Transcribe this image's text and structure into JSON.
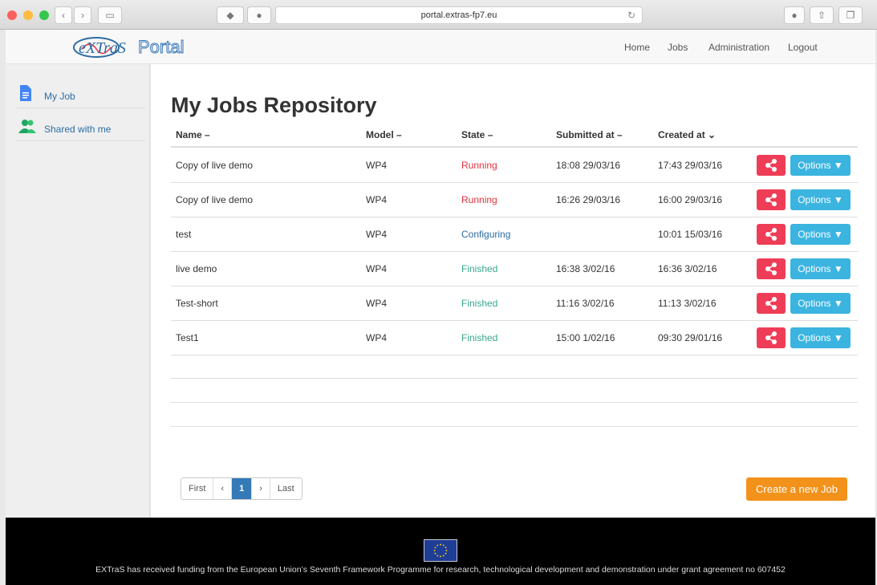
{
  "browser": {
    "url": "portal.extras-fp7.eu"
  },
  "header": {
    "logo_main": "eXTraS",
    "logo_sub": "Portal",
    "nav": [
      "Home",
      "Jobs",
      "Administration",
      "Logout"
    ]
  },
  "sidebar": {
    "items": [
      {
        "label": "My Job",
        "icon": "document-icon"
      },
      {
        "label": "Shared with me",
        "icon": "users-icon"
      }
    ]
  },
  "main": {
    "title": "My Jobs Repository",
    "columns": [
      "Name",
      "Model",
      "State",
      "Submitted at",
      "Created at"
    ],
    "rows": [
      {
        "name": "Copy of live demo",
        "model": "WP4",
        "state": "Running",
        "submitted": "18:08 29/03/16",
        "created": "17:43 29/03/16"
      },
      {
        "name": "Copy of live demo",
        "model": "WP4",
        "state": "Running",
        "submitted": "16:26 29/03/16",
        "created": "16:00 29/03/16"
      },
      {
        "name": "test",
        "model": "WP4",
        "state": "Configuring",
        "submitted": "",
        "created": "10:01 15/03/16"
      },
      {
        "name": "live demo",
        "model": "WP4",
        "state": "Finished",
        "submitted": "16:38 3/02/16",
        "created": "16:36 3/02/16"
      },
      {
        "name": "Test-short",
        "model": "WP4",
        "state": "Finished",
        "submitted": "11:16 3/02/16",
        "created": "11:13 3/02/16"
      },
      {
        "name": "Test1",
        "model": "WP4",
        "state": "Finished",
        "submitted": "15:00 1/02/16",
        "created": "09:30 29/01/16"
      }
    ],
    "options_label": "Options ▼",
    "pagination": {
      "first": "First",
      "prev": "‹",
      "current": "1",
      "next": "›",
      "last": "Last"
    },
    "create_label": "Create a new Job"
  },
  "state_colors": {
    "Running": "#e0323f",
    "Configuring": "#2d6ca2",
    "Finished": "#3aa78e"
  },
  "footer": {
    "text": "EXTraS has received funding from the European Union’s Seventh Framework Programme for research, technological development and demonstration under grant agreement no 607452"
  }
}
